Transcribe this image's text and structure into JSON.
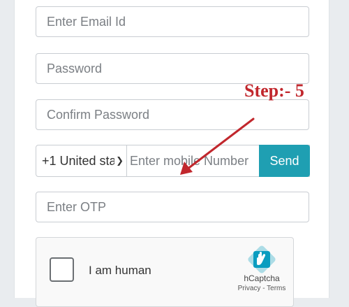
{
  "form": {
    "email_placeholder": "Enter Email Id",
    "password_placeholder": "Password",
    "confirm_password_placeholder": "Confirm Password",
    "country_code": "+1 United sta",
    "mobile_placeholder": "Enter mobile Number",
    "send_label": "Send",
    "otp_placeholder": "Enter OTP"
  },
  "captcha": {
    "label": "I am human",
    "brand": "hCaptcha",
    "links": "Privacy - Terms"
  },
  "annotation": {
    "step_label": "Step:- 5",
    "color": "#c1272d"
  },
  "colors": {
    "send_button": "#1f9fb2",
    "background": "#e9ecef"
  },
  "icons": [
    "chevron-down-icon",
    "hcaptcha-logo-icon",
    "arrow-annotation-icon"
  ]
}
